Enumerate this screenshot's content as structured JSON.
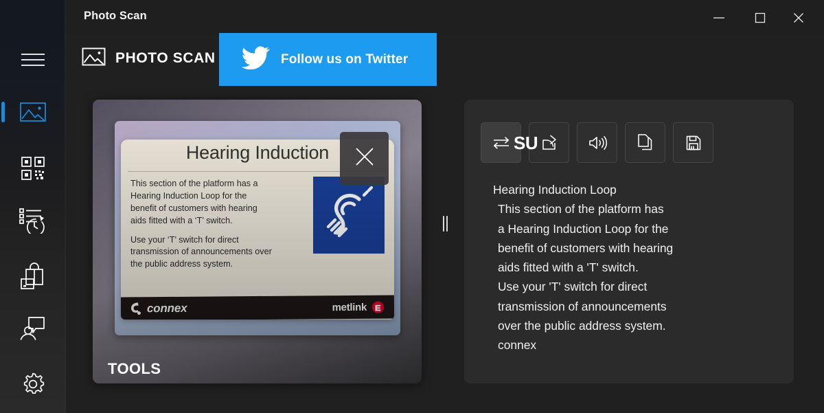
{
  "window": {
    "title": "Photo Scan",
    "controls": [
      {
        "name": "minimize",
        "label": "Minimize"
      },
      {
        "name": "maximize",
        "label": "Maximize"
      },
      {
        "name": "close",
        "label": "Close"
      }
    ]
  },
  "colors": {
    "accent": "#1a8ce0",
    "twitter_blue": "#1d9bf0",
    "titlebar_bg": "#1f1f1f",
    "app_bg": "#202020",
    "card_bg": "#2b2b2b",
    "sign_blue": "#123a96",
    "metlink_red": "#e4002b"
  },
  "sidebar": {
    "items": [
      {
        "icon": "hamburger-menu-icon",
        "label": "Menu",
        "selected": false
      },
      {
        "icon": "image-icon",
        "label": "Photo Scan",
        "selected": true
      },
      {
        "icon": "qr-code-icon",
        "label": "QR Code",
        "selected": false
      },
      {
        "icon": "history-icon",
        "label": "History",
        "selected": false
      },
      {
        "icon": "shopping-bag-icon",
        "label": "Store",
        "selected": false
      },
      {
        "icon": "feedback-person-icon",
        "label": "Feedback",
        "selected": false
      },
      {
        "icon": "settings-gear-icon",
        "label": "Settings",
        "selected": false
      }
    ]
  },
  "header": {
    "brand_icon": "image-icon",
    "brand_title": "PHOTO SCAN",
    "twitter_banner": {
      "icon": "twitter-bird-icon",
      "label": "Follow us on Twitter"
    }
  },
  "photo_panel": {
    "tools_label": "TOOLS",
    "close_icon": "close-icon",
    "sign": {
      "title": "Hearing Induction",
      "paragraphs": [
        "This section of the platform has a Hearing Induction Loop for the benefit of customers with hearing aids fitted with a ‘T’ switch.",
        "Use your ‘T’ switch for direct transmission of announcements over the public address system."
      ],
      "symbol_icon": "hearing-loop-ear-icon",
      "footer_left_logo": "connex",
      "footer_right_logo": "metlink"
    }
  },
  "splitter": {
    "name": "panel-splitter",
    "icon": "drag-handle-icon"
  },
  "result_panel": {
    "language_chip": "SU",
    "toolbar": [
      {
        "icon": "translate-swap-icon",
        "label": "Translate",
        "pressed": true
      },
      {
        "icon": "share-icon",
        "label": "Share",
        "pressed": false
      },
      {
        "icon": "speaker-icon",
        "label": "Read aloud",
        "pressed": false
      },
      {
        "icon": "copy-icon",
        "label": "Copy",
        "pressed": false
      },
      {
        "icon": "save-icon",
        "label": "Save",
        "pressed": false
      }
    ],
    "recognized_lines": [
      "Hearing Induction Loop",
      "This section of the platform has",
      "a Hearing Induction Loop for the",
      "benefit of customers with hearing",
      "aids fitted with a 'T' switch.",
      "Use your 'T' switch for direct",
      "transmission of announcements",
      "over the public address system.",
      "connex"
    ]
  }
}
